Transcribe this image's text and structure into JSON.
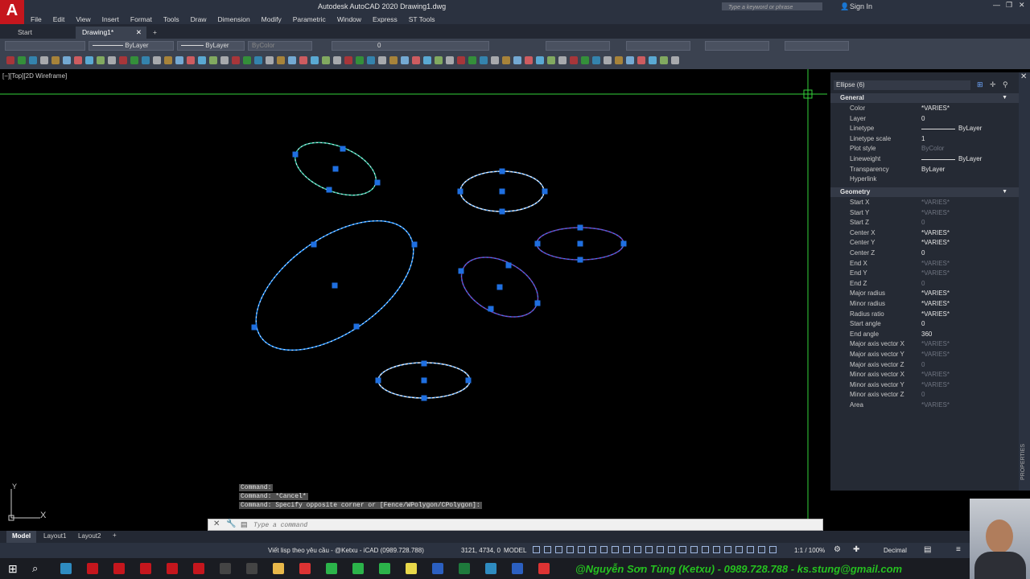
{
  "app": {
    "title": "Autodesk AutoCAD 2020   Drawing1.dwg",
    "search_placeholder": "Type a keyword or phrase",
    "sign_in": "Sign In"
  },
  "menu": [
    "File",
    "Edit",
    "View",
    "Insert",
    "Format",
    "Tools",
    "Draw",
    "Dimension",
    "Modify",
    "Parametric",
    "Window",
    "Express",
    "ST Tools"
  ],
  "tabs": {
    "start": "Start",
    "drawing": "Drawing1*",
    "add": "+"
  },
  "toolbar": {
    "linetype": "ByLayer",
    "lineweight": "ByLayer",
    "plotstyle": "ByColor",
    "layer": "0"
  },
  "viewport": {
    "label": "[−][Top][2D Wireframe]"
  },
  "ucs": {
    "x": "X",
    "y": "Y"
  },
  "properties": {
    "selection": "Ellipse (6)",
    "side_label": "PROPERTIES",
    "sections": {
      "general": "General",
      "geometry": "Geometry"
    },
    "general": [
      {
        "k": "Color",
        "v": "*VARIES*"
      },
      {
        "k": "Layer",
        "v": "0"
      },
      {
        "k": "Linetype",
        "v": "ByLayer"
      },
      {
        "k": "Linetype scale",
        "v": "1"
      },
      {
        "k": "Plot style",
        "v": "ByColor"
      },
      {
        "k": "Lineweight",
        "v": "ByLayer"
      },
      {
        "k": "Transparency",
        "v": "ByLayer"
      },
      {
        "k": "Hyperlink",
        "v": ""
      }
    ],
    "geometry": [
      {
        "k": "Start X",
        "v": "*VARIES*"
      },
      {
        "k": "Start Y",
        "v": "*VARIES*"
      },
      {
        "k": "Start Z",
        "v": "0"
      },
      {
        "k": "Center X",
        "v": "*VARIES*"
      },
      {
        "k": "Center Y",
        "v": "*VARIES*"
      },
      {
        "k": "Center Z",
        "v": "0"
      },
      {
        "k": "End X",
        "v": "*VARIES*"
      },
      {
        "k": "End Y",
        "v": "*VARIES*"
      },
      {
        "k": "End Z",
        "v": "0"
      },
      {
        "k": "Major radius",
        "v": "*VARIES*"
      },
      {
        "k": "Minor radius",
        "v": "*VARIES*"
      },
      {
        "k": "Radius ratio",
        "v": "*VARIES*"
      },
      {
        "k": "Start angle",
        "v": "0"
      },
      {
        "k": "End angle",
        "v": "360"
      },
      {
        "k": "Major axis vector X",
        "v": "*VARIES*"
      },
      {
        "k": "Major axis vector Y",
        "v": "*VARIES*"
      },
      {
        "k": "Major axis vector Z",
        "v": "0"
      },
      {
        "k": "Minor axis vector X",
        "v": "*VARIES*"
      },
      {
        "k": "Minor axis vector Y",
        "v": "*VARIES*"
      },
      {
        "k": "Minor axis vector Z",
        "v": "0"
      },
      {
        "k": "Area",
        "v": "*VARIES*"
      }
    ]
  },
  "command": {
    "history": [
      "Command:",
      "Command: *Cancel*",
      "Command: Specify opposite corner or [Fence/WPolygon/CPolygon]:"
    ],
    "placeholder": "Type a command"
  },
  "layouts": {
    "model": "Model",
    "layout1": "Layout1",
    "layout2": "Layout2",
    "add": "+"
  },
  "status": {
    "message": "Viết lisp theo yêu cầu - @Ketxu - iCAD (0989.728.788)",
    "coords": "3121, 4734, 0",
    "mode": "MODEL",
    "scale": "1:1 / 100%",
    "units": "Decimal"
  },
  "footer": {
    "text": "@Nguyễn Sơn Tùng (Ketxu) - 0989.728.788 - ks.stung@gmail.com"
  },
  "colors": {
    "cyan_white": "#e6f0ff",
    "blue": "#1e90ff",
    "teal": "#2dbf9a",
    "purple": "#7a3fb0",
    "grip": "#1f6fe0",
    "crosshair": "#35d23a"
  }
}
